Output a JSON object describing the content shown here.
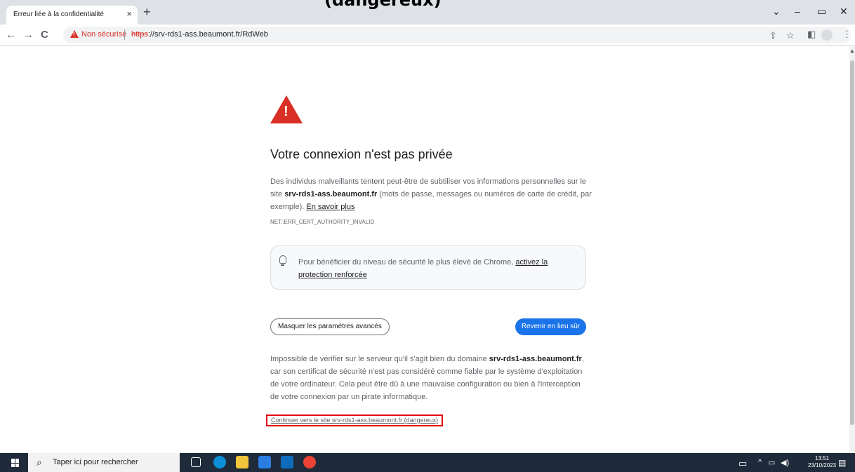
{
  "overlay": {
    "heading": "(dangereux)"
  },
  "browser": {
    "tab": {
      "title": "Erreur liée à la confidentialité",
      "close": "×"
    },
    "new_tab": "+",
    "window_controls": {
      "dropdown": "⌄",
      "minimize": "–",
      "restore": "▭",
      "close": "✕"
    },
    "nav": {
      "back": "←",
      "forward": "→",
      "reload": "C"
    },
    "omnibox": {
      "not_secure_label": "Non sécurisé",
      "url_scheme": "https",
      "url_rest": "://srv-rds1-ass.beaumont.fr/RdWeb"
    },
    "toolbar_icons": {
      "share": "⇪",
      "bookmark": "☆",
      "sidepanel": "◧",
      "menu": "⋮"
    }
  },
  "page": {
    "title": "Votre connexion n'est pas privée",
    "desc_before": "Des individus malveillants tentent peut-être de subtiliser vos informations personnelles sur le site ",
    "domain": "srv-rds1-ass.beaumont.fr",
    "desc_after": " (mots de passe, messages ou numéros de carte de crédit, par exemple). ",
    "learn_more": "En savoir plus",
    "error_code": "NET::ERR_CERT_AUTHORITY_INVALID",
    "info_box_text": "Pour bénéficier du niveau de sécurité le plus élevé de Chrome, ",
    "info_box_link": "activez la protection renforcée",
    "hide_advanced": "Masquer les paramètres avancés",
    "back_to_safety": "Revenir en lieu sûr",
    "explain_before": "Impossible de vérifier sur le serveur qu'il s'agit bien du domaine ",
    "explain_domain": "srv-rds1-ass.beaumont.fr",
    "explain_after": ", car son certificat de sécurité n'est pas considéré comme fiable par le système d'exploitation de votre ordinateur. Cela peut être dû à une mauvaise configuration ou bien à l'interception de votre connexion par un pirate informatique.",
    "proceed_link": "Continuer vers le site srv-rds1-ass.beaumont.fr (dangereux)"
  },
  "taskbar": {
    "search_placeholder": "Taper ici pour rechercher",
    "search_icon": "⌕",
    "apps": [
      {
        "name": "task-view-icon",
        "color": "#1f2b3a"
      },
      {
        "name": "edge-icon",
        "color": "#0c8fd6"
      },
      {
        "name": "file-explorer-icon",
        "color": "#f2c53d"
      },
      {
        "name": "store-icon",
        "color": "#2a7de1"
      },
      {
        "name": "mail-icon",
        "color": "#0f6cbd"
      },
      {
        "name": "chrome-icon",
        "color": "#ea4335"
      }
    ],
    "tray_chevron": "^",
    "clock_time": "13:51",
    "clock_date": "23/10/2023"
  },
  "colors": {
    "danger": "#d93025",
    "primary": "#1a73e8",
    "highlight_box": "#e30613"
  }
}
